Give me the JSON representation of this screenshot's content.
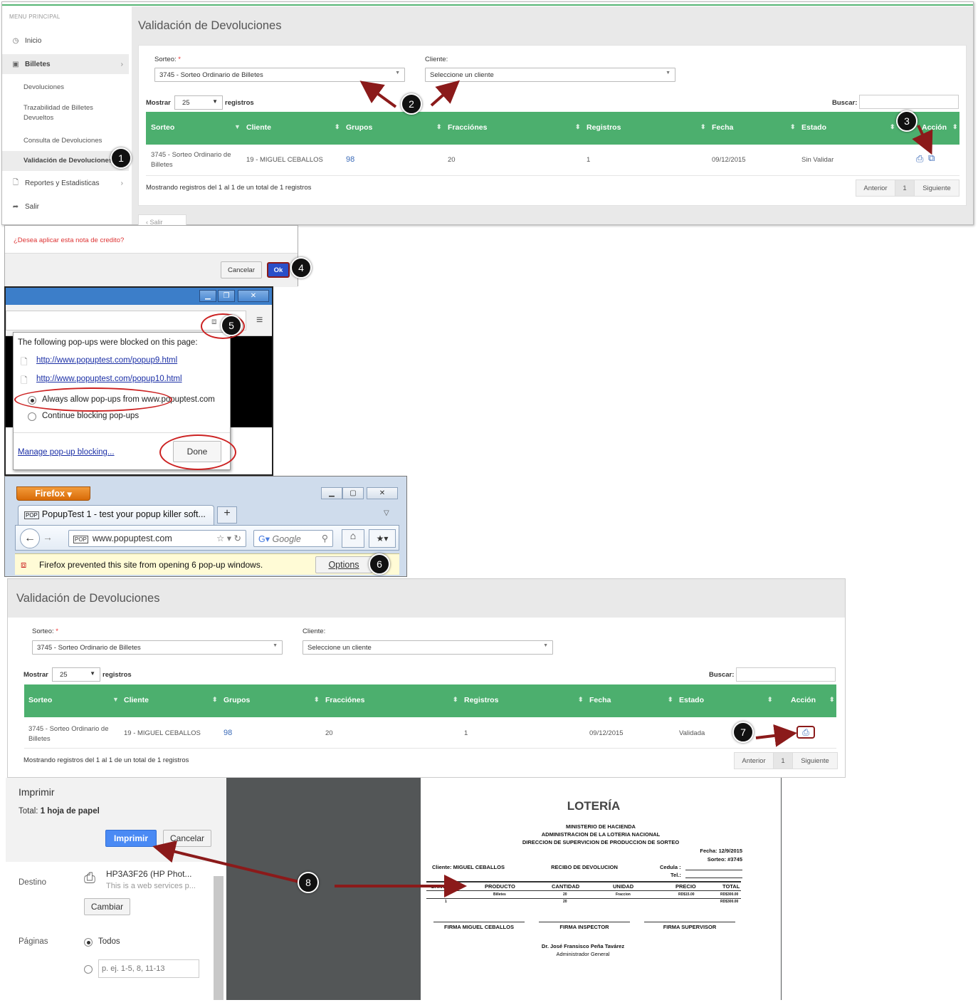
{
  "panel1": {
    "sidebar": {
      "header": "MENU PRINCIPAL",
      "items": [
        {
          "label": "Inicio",
          "icon": "clock-icon"
        },
        {
          "label": "Billetes",
          "icon": "ticket-icon"
        },
        {
          "label": "Reportes y Estadisticas",
          "icon": "document-icon"
        },
        {
          "label": "Salir",
          "icon": "logout-icon"
        }
      ],
      "subitems": [
        "Devoluciones",
        "Trazabilidad de Billetes Devueltos",
        "Consulta de Devoluciones",
        "Validación de Devoluciones"
      ]
    },
    "title": "Validación de Devoluciones",
    "sorteo_label": "Sorteo:",
    "required_mark": "*",
    "sorteo_value": "3745 - Sorteo Ordinario de Billetes",
    "cliente_label": "Cliente:",
    "cliente_value": "Seleccione un cliente",
    "mostrar": "Mostrar",
    "length": "25",
    "registros": "registros",
    "buscar": "Buscar:",
    "columns": [
      "Sorteo",
      "Cliente",
      "Grupos",
      "Fracciónes",
      "Registros",
      "Fecha",
      "Estado",
      "Acción"
    ],
    "row": {
      "sorteo": "3745 - Sorteo Ordinario de Billetes",
      "cliente": "19 - MIGUEL CEBALLOS",
      "grupos": "98",
      "fracciones": "20",
      "registros": "1",
      "fecha": "09/12/2015",
      "estado": "Sin Validar"
    },
    "info": "Mostrando registros del 1 al 1 de un total de 1 registros",
    "prev": "Anterior",
    "page": "1",
    "next": "Siguiente",
    "partial_tab": "Salir"
  },
  "dialog": {
    "question": "¿Desea aplicar esta nota de credito?",
    "cancel": "Cancelar",
    "ok": "Ok"
  },
  "chrome_popup": {
    "heading": "The following pop-ups were blocked on this page:",
    "link1": "http://www.popuptest.com/popup9.html",
    "link2": "http://www.popuptest.com/popup10.html",
    "opt_allow": "Always allow pop-ups from www.popuptest.com",
    "opt_block": "Continue blocking pop-ups",
    "manage": "Manage pop-up blocking...",
    "done": "Done"
  },
  "firefox": {
    "menu": "Firefox",
    "tab": "PopupTest 1 - test your popup killer soft...",
    "url": "www.popuptest.com",
    "search": "Google",
    "message": "Firefox prevented this site from opening 6 pop-up windows.",
    "options": "Options"
  },
  "panel5": {
    "title": "Validación de Devoluciones",
    "sorteo_label": "Sorteo:",
    "required_mark": "*",
    "sorteo_value": "3745 - Sorteo Ordinario de Billetes",
    "cliente_label": "Cliente:",
    "cliente_value": "Seleccione un cliente",
    "mostrar": "Mostrar",
    "length": "25",
    "registros": "registros",
    "buscar": "Buscar:",
    "columns": [
      "Sorteo",
      "Cliente",
      "Grupos",
      "Fracciónes",
      "Registros",
      "Fecha",
      "Estado",
      "Acción"
    ],
    "row": {
      "sorteo": "3745 - Sorteo Ordinario de Billetes",
      "cliente": "19 - MIGUEL CEBALLOS",
      "grupos": "98",
      "fracciones": "20",
      "registros": "1",
      "fecha": "09/12/2015",
      "estado": "Validada"
    },
    "info": "Mostrando registros del 1 al 1 de un total de 1 registros",
    "prev": "Anterior",
    "page": "1",
    "next": "Siguiente"
  },
  "print": {
    "title": "Imprimir",
    "total_label": "Total:",
    "total_value": "1 hoja de papel",
    "print_btn": "Imprimir",
    "cancel_btn": "Cancelar",
    "dest_label": "Destino",
    "printer": "HP3A3F26 (HP Phot...",
    "printer_sub": "This is a web services p...",
    "change": "Cambiar",
    "pages_label": "Páginas",
    "all": "Todos",
    "range_placeholder": "p. ej. 1-5, 8, 11-13"
  },
  "receipt": {
    "logo": "LOTERÍA",
    "l1": "MINISTERIO DE HACIENDA",
    "l2": "ADMINISTRACION DE LA LOTERIA NACIONAL",
    "l3": "DIRECCION DE SUPERVICION DE PRODUCCION DE SORTEO",
    "fecha": "Fecha: 12/9/2015",
    "sorteo": "Sorteo: #3745",
    "cliente": "Cliente: MIGUEL CEBALLOS",
    "recibo": "RECIBO DE DEVOLUCION",
    "cedula": "Cedula :",
    "tel": "Tel.:",
    "cols": [
      "CANT.",
      "PRODUCTO",
      "CANTIDAD",
      "UNIDAD",
      "PRECIO",
      "TOTAL"
    ],
    "r1": [
      "98",
      "Billetes",
      "20",
      "Fraccion",
      "RD$15.00",
      "RD$300.00"
    ],
    "r2": [
      "1",
      "20",
      "RD$300.00"
    ],
    "sig1": "FIRMA MIGUEL CEBALLOS",
    "sig2": "FIRMA INSPECTOR",
    "sig3": "FIRMA SUPERVISOR",
    "admin_name": "Dr. José Fransisco Peña Tavárez",
    "admin_title": "Administrador General"
  },
  "badges": [
    "1",
    "2",
    "3",
    "4",
    "5",
    "6",
    "7",
    "8"
  ],
  "colors": {
    "green_header": "#4caf6e",
    "arrow": "#8b1a1a",
    "ok_blue": "#2a4fc8",
    "link_blue": "#3a6ab8"
  }
}
